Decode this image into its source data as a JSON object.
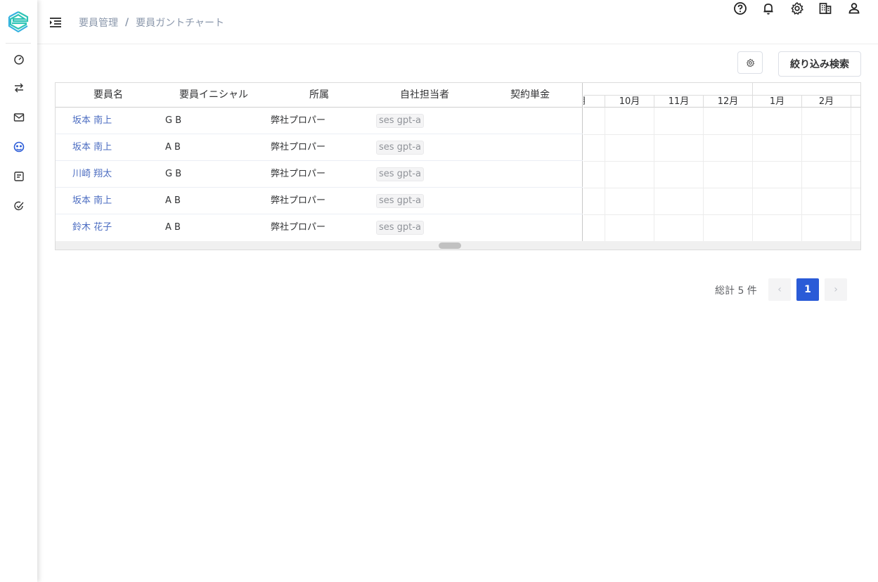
{
  "sidebar": {
    "items": [
      {
        "name": "dashboard-icon"
      },
      {
        "name": "transfer-icon"
      },
      {
        "name": "mail-icon"
      },
      {
        "name": "personnel-icon",
        "active": true
      },
      {
        "name": "notes-icon"
      },
      {
        "name": "task-check-icon"
      }
    ],
    "active_color": "#2a5bd7",
    "icon_color": "#333333"
  },
  "header": {
    "breadcrumb": [
      "要員管理",
      "要員ガントチャート"
    ],
    "breadcrumb_sep": "/",
    "icons": [
      "help-icon",
      "bell-icon",
      "settings-icon",
      "company-icon",
      "user-icon"
    ]
  },
  "toolbar": {
    "filter_label": "絞り込み検索"
  },
  "table": {
    "columns": [
      "要員名",
      "要員イニシャル",
      "所属",
      "自社担当者",
      "契約単金"
    ],
    "rows": [
      {
        "name": "坂本 南上",
        "initial": "G B",
        "affiliation": "弊社プロパー",
        "manager": "ses gpt-a",
        "price": ""
      },
      {
        "name": "坂本 南上",
        "initial": "A B",
        "affiliation": "弊社プロパー",
        "manager": "ses gpt-a",
        "price": ""
      },
      {
        "name": "川崎 翔太",
        "initial": "G B",
        "affiliation": "弊社プロパー",
        "manager": "ses gpt-a",
        "price": ""
      },
      {
        "name": "坂本 南上",
        "initial": "A B",
        "affiliation": "弊社プロパー",
        "manager": "ses gpt-a",
        "price": ""
      },
      {
        "name": "鈴木 花子",
        "initial": "A B",
        "affiliation": "弊社プロパー",
        "manager": "ses gpt-a",
        "price": ""
      }
    ]
  },
  "gantt": {
    "partial_month": "月",
    "months": [
      "10月",
      "11月",
      "12月",
      "1月",
      "2月"
    ]
  },
  "pagination": {
    "total_label": "総計 5 件",
    "current_page": "1",
    "prev": "‹",
    "next": "›"
  }
}
